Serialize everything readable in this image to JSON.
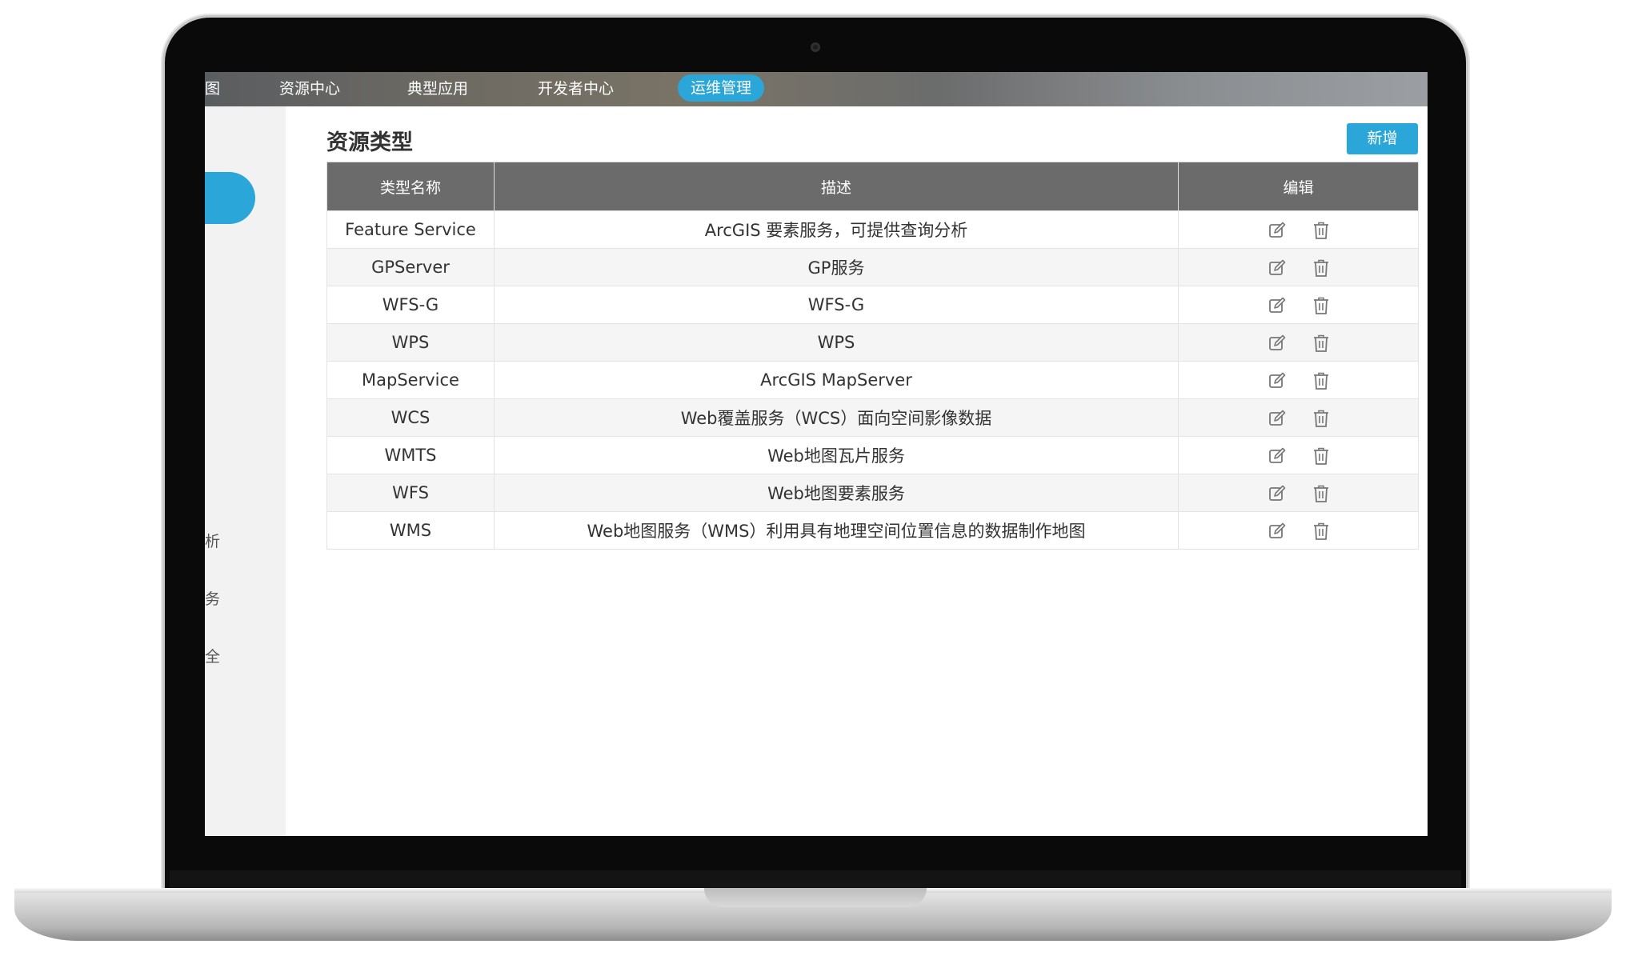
{
  "nav": {
    "partial_item": "图",
    "items": [
      "资源中心",
      "典型应用",
      "开发者中心"
    ],
    "active_item": "运维管理"
  },
  "sidebar": {
    "partial_items": [
      "析",
      "务",
      "全"
    ]
  },
  "page": {
    "title": "资源类型",
    "add_button": "新增"
  },
  "table": {
    "headers": [
      "类型名称",
      "描述",
      "编辑"
    ],
    "rows": [
      {
        "name": "Feature Service",
        "desc": "ArcGIS 要素服务，可提供查询分析"
      },
      {
        "name": "GPServer",
        "desc": "GP服务"
      },
      {
        "name": "WFS-G",
        "desc": "WFS-G"
      },
      {
        "name": "WPS",
        "desc": "WPS"
      },
      {
        "name": "MapService",
        "desc": "ArcGIS MapServer"
      },
      {
        "name": "WCS",
        "desc": "Web覆盖服务（WCS）面向空间影像数据"
      },
      {
        "name": "WMTS",
        "desc": "Web地图瓦片服务"
      },
      {
        "name": "WFS",
        "desc": "Web地图要素服务"
      },
      {
        "name": "WMS",
        "desc": "Web地图服务（WMS）利用具有地理空间位置信息的数据制作地图"
      }
    ],
    "row_actions": [
      "edit-icon",
      "trash-icon"
    ]
  },
  "colors": {
    "accent": "#2aa6d9",
    "header_bg": "#6b6b6b",
    "stripe": "#f5f5f5"
  }
}
